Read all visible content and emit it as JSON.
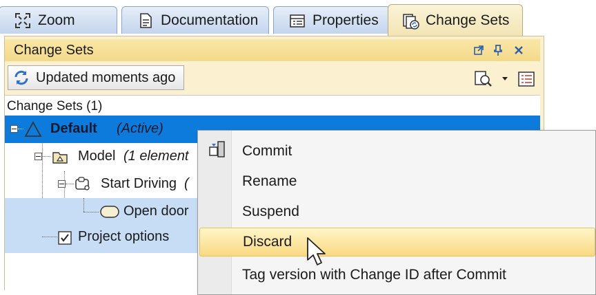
{
  "tabs": [
    {
      "label": "Zoom",
      "icon": "zoom-icon"
    },
    {
      "label": "Documentation",
      "icon": "document-icon"
    },
    {
      "label": "Properties",
      "icon": "properties-icon"
    },
    {
      "label": "Change Sets",
      "icon": "change-sets-icon",
      "active": true
    }
  ],
  "panel": {
    "title": "Change Sets",
    "toolbar": {
      "update_label": "Updated moments ago"
    }
  },
  "tree": {
    "header": "Change Sets (1)",
    "rows": [
      {
        "label": "Default",
        "suffix": "(Active)",
        "selected": true
      },
      {
        "label": "Model",
        "suffix": "(1 element"
      },
      {
        "label": "Start Driving",
        "suffix": "("
      },
      {
        "label": "Open door",
        "suffix": ""
      },
      {
        "label": "Project options",
        "suffix": "",
        "checked": true
      }
    ]
  },
  "context_menu": {
    "items": [
      {
        "label": "Commit"
      },
      {
        "label": "Rename"
      },
      {
        "label": "Suspend"
      },
      {
        "label": "Discard",
        "hover": true
      },
      {
        "label": "Tag version with Change ID after Commit"
      }
    ]
  },
  "colors": {
    "selection": "#0c7bdc",
    "highlight_row": "#c7ddf5",
    "panel_bg": "#fbf0cf",
    "menu_hover": "#f9d981"
  }
}
